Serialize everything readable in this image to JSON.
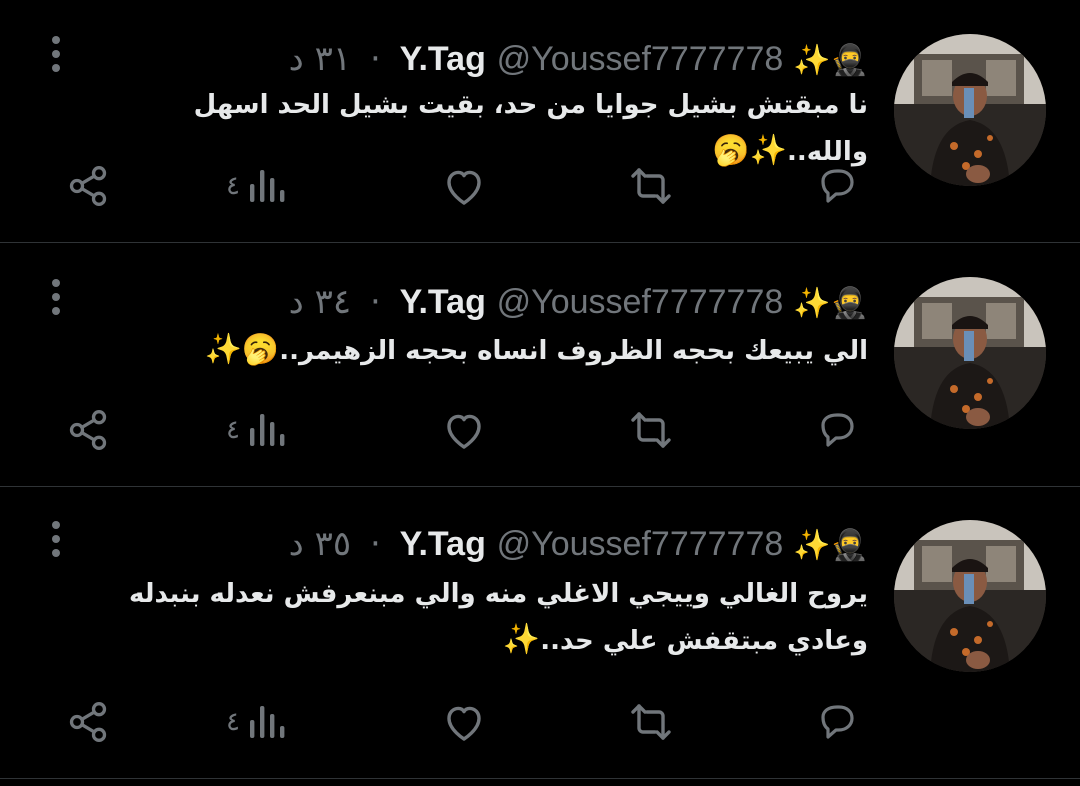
{
  "theme": {
    "background": "#000000",
    "text": "#e7e9ea",
    "muted": "#71767b",
    "divider": "#2f3336"
  },
  "tweets": [
    {
      "display_name": "Y.Tag",
      "name_emoji": "🥷✨",
      "handle": "@Youssef7777778",
      "separator": "·",
      "time": "٣١ د",
      "text": "نا مبقتش بشيل جوايا من حد، بقيت بشيل الحد اسهل والله..",
      "text_emoji": "✨🥱",
      "views": "٤",
      "icons": [
        "reply-icon",
        "retweet-icon",
        "like-icon",
        "views-icon",
        "share-icon",
        "more-icon"
      ]
    },
    {
      "display_name": "Y.Tag",
      "name_emoji": "🥷✨",
      "handle": "@Youssef7777778",
      "separator": "·",
      "time": "٣٤ د",
      "text": "الي يبيعك بحجه الظروف انساه بحجه الزهيمر..",
      "text_emoji": "🥱✨",
      "views": "٤",
      "icons": [
        "reply-icon",
        "retweet-icon",
        "like-icon",
        "views-icon",
        "share-icon",
        "more-icon"
      ]
    },
    {
      "display_name": "Y.Tag",
      "name_emoji": "🥷✨",
      "handle": "@Youssef7777778",
      "separator": "·",
      "time": "٣٥ د",
      "text": "يروح الغالي وييجي الاغلي منه والي مبنعرفش نعدله بنبدله وعادي مبتقفش علي حد..",
      "text_emoji": "✨",
      "views": "٤",
      "icons": [
        "reply-icon",
        "retweet-icon",
        "like-icon",
        "views-icon",
        "share-icon",
        "more-icon"
      ]
    }
  ]
}
